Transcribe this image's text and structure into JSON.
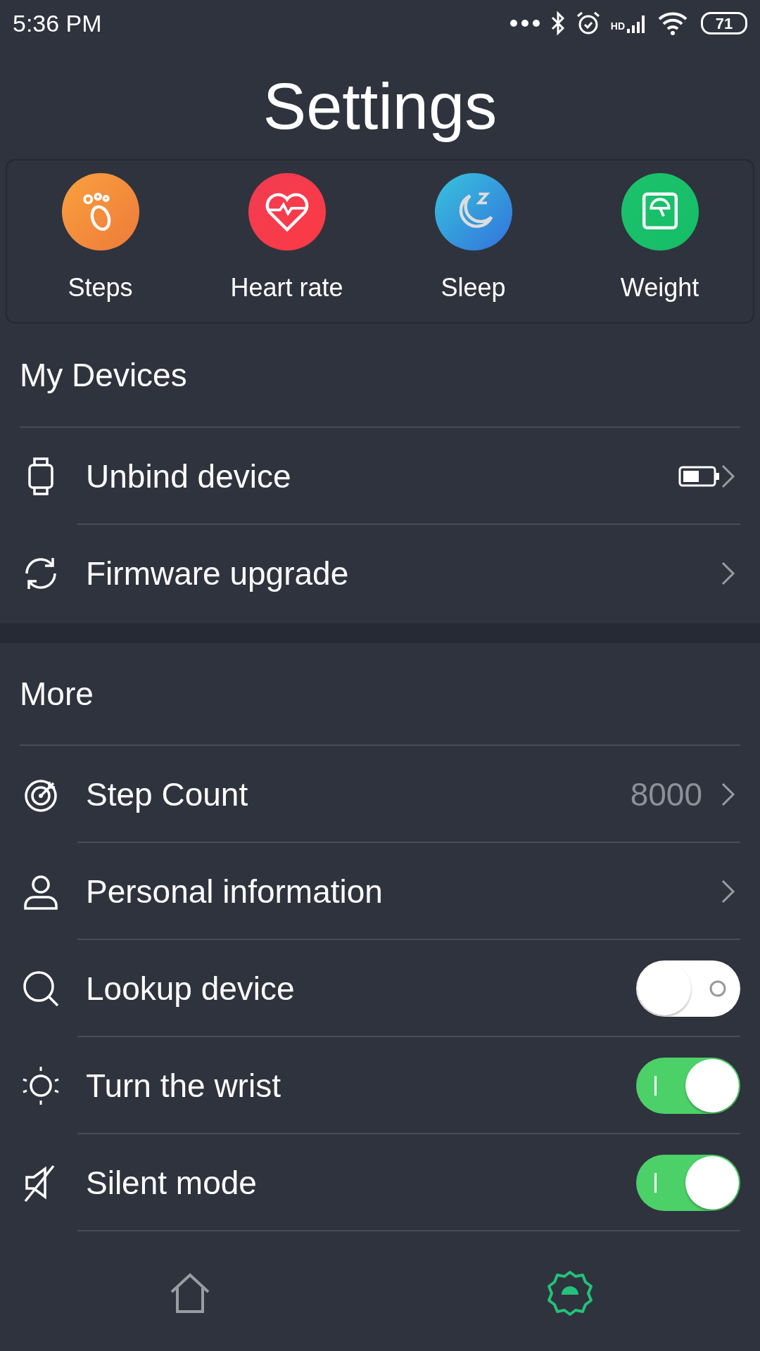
{
  "status_bar": {
    "time": "5:36 PM",
    "network": "HD",
    "battery": "71"
  },
  "title": "Settings",
  "shortcuts": [
    {
      "label": "Steps"
    },
    {
      "label": "Heart rate"
    },
    {
      "label": "Sleep"
    },
    {
      "label": "Weight"
    }
  ],
  "sections": [
    {
      "title": "My Devices",
      "items": [
        {
          "kind": "battery-link",
          "label": "Unbind device"
        },
        {
          "kind": "link",
          "label": "Firmware upgrade"
        }
      ]
    },
    {
      "title": "More",
      "items": [
        {
          "kind": "value-link",
          "label": "Step Count",
          "value": "8000"
        },
        {
          "kind": "link",
          "label": "Personal information"
        },
        {
          "kind": "toggle",
          "label": "Lookup device",
          "on": false
        },
        {
          "kind": "toggle",
          "label": "Turn the wrist",
          "on": true
        },
        {
          "kind": "toggle",
          "label": "Silent mode",
          "on": true
        }
      ]
    }
  ],
  "bottom_nav": [
    {
      "selected": false
    },
    {
      "selected": true
    }
  ]
}
